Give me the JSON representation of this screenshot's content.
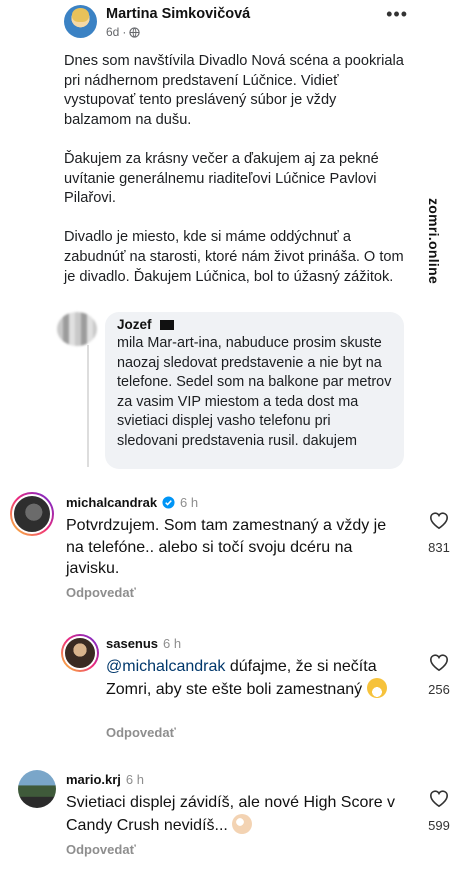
{
  "post": {
    "author": "Martina Simkovičová",
    "time": "6d",
    "separator": "·",
    "more": "•••",
    "paragraphs": [
      "Dnes som navštívila Divadlo Nová scéna a pookriala pri nádhernom predstavení Lúčnice. Vidieť vystupovať tento preslávený súbor je vždy balzamom na dušu.",
      "Ďakujem za krásny večer a ďakujem aj za pekné uvítanie generálnemu riaditeľovi Lúčnice Pavlovi Pilařovi.",
      "Divadlo je miesto, kde si máme oddýchnuť a zabudnúť na starosti, ktoré nám život prináša. O tom je divadlo. Ďakujem Lúčnica, bol to úžasný zážitok."
    ]
  },
  "reply": {
    "name": "Jozef",
    "text": "mila Mar-art-ina, nabuduce prosim skuste naozaj sledovat predstavenie a nie byt na telefone. Sedel som na balkone par metrov za vasim VIP miestom a teda dost ma svietiaci displej vasho telefonu pri sledovani predstavenia rusil. dakujem"
  },
  "watermark": "zomri.online",
  "comments": [
    {
      "username": "michalcandrak",
      "time": "6 h",
      "verified": true,
      "text": "Potvrdzujem. Som tam zamestnaný a vždy je na telefóne.. alebo si točí svoju dcéru na javisku.",
      "reply_label": "Odpovedať",
      "likes": "831"
    },
    {
      "username": "sasenus",
      "time": "6 h",
      "mention": "@michalcandrak",
      "text": " dúfajme, že si nečíta Zomri, aby ste ešte boli zamestnaný",
      "emoji": "grinning-face-emoji",
      "reply_label": "Odpovedať",
      "likes": "256"
    },
    {
      "username": "mario.krj",
      "time": "6 h",
      "text": "Svietiaci displej závidíš, ale nové High Score v Candy Crush nevidíš...",
      "emoji": "ok-hand-emoji",
      "reply_label": "Odpovedať",
      "likes": "599"
    }
  ]
}
